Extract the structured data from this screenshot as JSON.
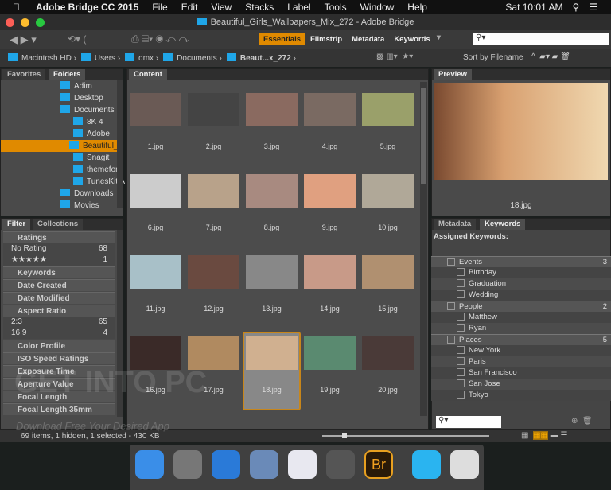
{
  "menubar": {
    "app": "Adobe Bridge CC 2015",
    "items": [
      "File",
      "Edit",
      "View",
      "Stacks",
      "Label",
      "Tools",
      "Window",
      "Help"
    ],
    "clock": "Sat 10:01 AM"
  },
  "window": {
    "title": "Beautiful_Girls_Wallpapers_Mix_272 - Adobe Bridge"
  },
  "toolbar": {
    "workspaces": [
      "Essentials",
      "Filmstrip",
      "Metadata",
      "Keywords"
    ],
    "active": "Essentials",
    "search_placeholder": ""
  },
  "path": {
    "crumbs": [
      "Macintosh HD",
      "Users",
      "dmx",
      "Documents",
      "Beaut...x_272"
    ],
    "sort": "Sort by Filename"
  },
  "left": {
    "tabs": [
      "Favorites",
      "Folders"
    ],
    "folders": [
      "Adim",
      "Desktop",
      "Documents",
      "8K  4",
      "Adobe",
      "Beautiful_",
      "Snagit",
      "themefore",
      "TunesKit A",
      "Downloads",
      "Movies"
    ],
    "filter_tabs": [
      "Filter",
      "Collections"
    ],
    "filters": [
      {
        "label": "Ratings",
        "open": true,
        "items": [
          [
            "No Rating",
            "68"
          ],
          [
            "★★★★★",
            "1"
          ]
        ]
      },
      {
        "label": "Keywords"
      },
      {
        "label": "Date Created"
      },
      {
        "label": "Date Modified"
      },
      {
        "label": "Aspect Ratio",
        "open": true,
        "items": [
          [
            "2:3",
            "65"
          ],
          [
            "16:9",
            "4"
          ]
        ]
      },
      {
        "label": "Color Profile"
      },
      {
        "label": "ISO Speed Ratings"
      },
      {
        "label": "Exposure Time"
      },
      {
        "label": "Aperture Value"
      },
      {
        "label": "Focal Length"
      },
      {
        "label": "Focal Length 35mm"
      }
    ]
  },
  "content": {
    "tab": "Content",
    "files": [
      "1.jpg",
      "2.jpg",
      "3.jpg",
      "4.jpg",
      "5.jpg",
      "6.jpg",
      "7.jpg",
      "8.jpg",
      "9.jpg",
      "10.jpg",
      "11.jpg",
      "12.jpg",
      "13.jpg",
      "14.jpg",
      "15.jpg",
      "16.jpg",
      "17.jpg",
      "18.jpg",
      "19.jpg",
      "20.jpg"
    ],
    "selected": "18.jpg",
    "thumb_colors": [
      "#6a5a55",
      "#444",
      "#8a6a60",
      "#7a6a62",
      "#9aa06a",
      "#ccc",
      "#b8a28a",
      "#a88a80",
      "#e0a080",
      "#b0a898",
      "#a8c0c8",
      "#6a4a40",
      "#888",
      "#c89a88",
      "#b09070",
      "#3a2a28",
      "#b08a60",
      "#d0b090",
      "#5a8a70",
      "#4a3a38"
    ]
  },
  "preview": {
    "tab": "Preview",
    "file": "18.jpg"
  },
  "keywords": {
    "tabs": [
      "Metadata",
      "Keywords"
    ],
    "assigned_label": "Assigned Keywords:",
    "groups": [
      {
        "name": "Events",
        "count": "3",
        "items": [
          "Birthday",
          "Graduation",
          "Wedding"
        ]
      },
      {
        "name": "People",
        "count": "2",
        "items": [
          "Matthew",
          "Ryan"
        ]
      },
      {
        "name": "Places",
        "count": "5",
        "items": [
          "New York",
          "Paris",
          "San Francisco",
          "San Jose",
          "Tokyo"
        ]
      }
    ]
  },
  "status": {
    "text": "69 items, 1 hidden, 1 selected - 430 KB",
    "thumb_size_percent": 12
  },
  "watermark": {
    "line1": "GET INTO PC",
    "line2": "Download Free Your Desired App"
  },
  "dock": {
    "apps": [
      "Finder",
      "Launchpad",
      "Safari",
      "Mail",
      "iTunes",
      "System Preferences",
      "Br",
      "Downloads",
      "Trash"
    ]
  },
  "colors": {
    "accent": "#e08a00",
    "folder": "#1fa6e8"
  }
}
